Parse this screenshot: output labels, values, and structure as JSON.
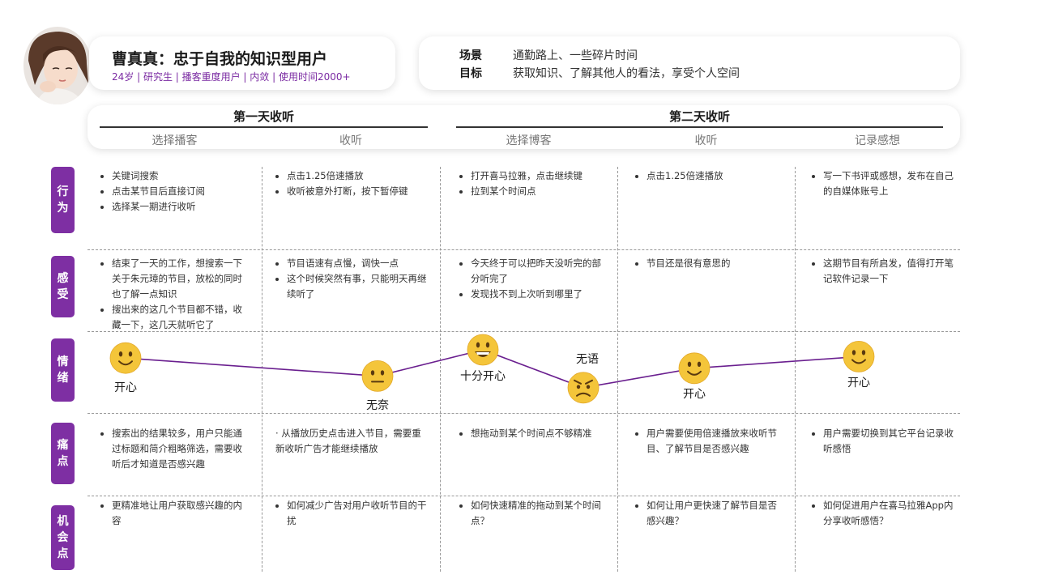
{
  "persona": {
    "name": "曹真真：忠于自我的知识型用户",
    "tags": "24岁 | 研究生 | 播客重度用户 | 内敛 | 使用时间2000+"
  },
  "context": {
    "scene_label": "场景",
    "scene_value": "通勤路上、一些碎片时间",
    "goal_label": "目标",
    "goal_value": "获取知识、了解其他人的看法，享受个人空间"
  },
  "stages": [
    {
      "title": "第一天收听"
    },
    {
      "title": "第二天收听"
    }
  ],
  "phases": [
    {
      "label": "选择播客"
    },
    {
      "label": "收听"
    },
    {
      "label": "选择博客"
    },
    {
      "label": "收听"
    },
    {
      "label": "记录感想"
    }
  ],
  "rows": [
    {
      "label": "行为"
    },
    {
      "label": "感受"
    },
    {
      "label": "情绪"
    },
    {
      "label": "痛点"
    },
    {
      "label": "机会点"
    }
  ],
  "cells": {
    "behavior": [
      {
        "items": [
          "关键词搜索",
          "点击某节目后直接订阅",
          "选择某一期进行收听"
        ]
      },
      {
        "items": [
          "点击1.25倍速播放",
          "收听被意外打断，按下暂停键"
        ]
      },
      {
        "items": [
          "打开喜马拉雅，点击继续键",
          "拉到某个时间点"
        ]
      },
      {
        "items": [
          "点击1.25倍速播放"
        ]
      },
      {
        "items": [
          "写一下书评或感想，发布在自己的自媒体账号上"
        ]
      }
    ],
    "feeling": [
      {
        "items": [
          "结束了一天的工作，想搜索一下关于朱元璋的节目，放松的同时也了解一点知识",
          "搜出来的这几个节目都不错，收藏一下，这几天就听它了"
        ]
      },
      {
        "items": [
          "节目语速有点慢，调快一点",
          "这个时候突然有事，只能明天再继续听了"
        ]
      },
      {
        "items": [
          "今天终于可以把昨天没听完的部分听完了",
          "发现找不到上次听到哪里了"
        ]
      },
      {
        "items": [
          "节目还是很有意思的"
        ]
      },
      {
        "items": [
          "这期节目有所启发，值得打开笔记软件记录一下"
        ]
      }
    ],
    "pain": [
      {
        "items": [
          "搜索出的结果较多，用户只能通过标题和简介粗略筛选，需要收听后才知道是否感兴趣"
        ]
      },
      {
        "plain": "· 从播放历史点击进入节目，需要重新收听广告才能继续播放"
      },
      {
        "items": [
          "想拖动到某个时间点不够精准"
        ]
      },
      {
        "items": [
          "用户需要使用倍速播放来收听节目、了解节目是否感兴趣"
        ]
      },
      {
        "items": [
          "用户需要切换到其它平台记录收听感悟"
        ]
      }
    ],
    "opportunity": [
      {
        "items": [
          "更精准地让用户获取感兴趣的内容"
        ]
      },
      {
        "items": [
          "如何减少广告对用户收听节目的干扰"
        ]
      },
      {
        "items": [
          "如何快速精准的拖动到某个时间点？"
        ]
      },
      {
        "items": [
          "如何让用户更快速了解节目是否感兴趣？"
        ]
      },
      {
        "items": [
          "如何促进用户在喜马拉雅App内分享收听感悟？"
        ]
      }
    ]
  },
  "emotion_points": [
    {
      "label": "开心",
      "face": "smile",
      "level": 0.83
    },
    {
      "label": "无奈",
      "face": "neutral",
      "level": 0.46
    },
    {
      "label": "十分开心",
      "face": "grin",
      "level": 1.0
    },
    {
      "label": "无语",
      "face": "angry",
      "level": 0.22
    },
    {
      "label": "开心",
      "face": "smile",
      "level": 0.62
    },
    {
      "label": "开心",
      "face": "smile",
      "level": 0.86
    }
  ],
  "colors": {
    "accent": "#7e2fa3",
    "emotion_line": "#6a1f8f",
    "emoji_fill": "#f4c53a"
  }
}
